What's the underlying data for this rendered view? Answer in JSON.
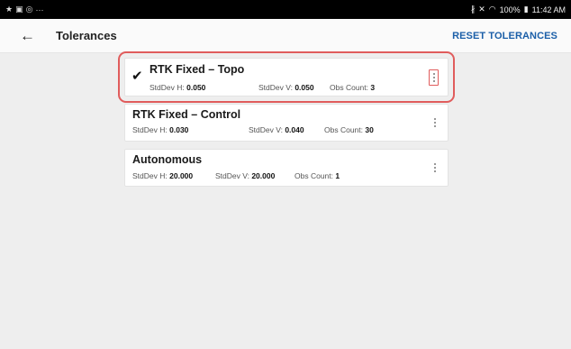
{
  "status_bar": {
    "left_icons": [
      "star-icon",
      "image-icon",
      "chat-icon",
      "more-icon"
    ],
    "battery": "100%",
    "time": "11:42 AM"
  },
  "header": {
    "title": "Tolerances",
    "reset_label": "RESET TOLERANCES"
  },
  "tolerances": [
    {
      "name": "RTK Fixed – Topo",
      "selected": true,
      "stddev_h_label": "StdDev H:",
      "stddev_h": "0.050",
      "stddev_v_label": "StdDev V:",
      "stddev_v": "0.050",
      "obs_label": "Obs Count:",
      "obs_count": "3"
    },
    {
      "name": "RTK Fixed – Control",
      "selected": false,
      "stddev_h_label": "StdDev H:",
      "stddev_h": "0.030",
      "stddev_v_label": "StdDev V:",
      "stddev_v": "0.040",
      "obs_label": "Obs Count:",
      "obs_count": "30"
    },
    {
      "name": "Autonomous",
      "selected": false,
      "stddev_h_label": "StdDev H:",
      "stddev_h": "20.000",
      "stddev_v_label": "StdDev V:",
      "stddev_v": "20.000",
      "obs_label": "Obs Count:",
      "obs_count": "1"
    }
  ]
}
